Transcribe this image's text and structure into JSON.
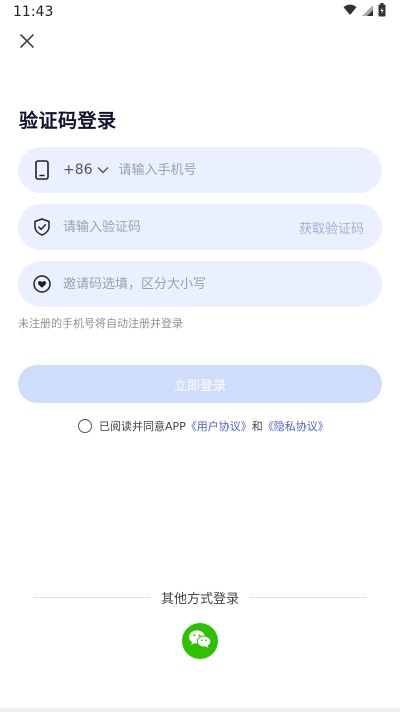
{
  "status_bar": {
    "time": "11:43",
    "icons": [
      "wifi-icon",
      "signal-icon",
      "battery-icon"
    ]
  },
  "header": {
    "close_icon": "close-icon"
  },
  "title": "验证码登录",
  "phone": {
    "icon": "phone-icon",
    "country_code": "+86",
    "placeholder": "请输入手机号",
    "value": ""
  },
  "code": {
    "icon": "shield-icon",
    "placeholder": "请输入验证码",
    "value": "",
    "get_code_label": "获取验证码"
  },
  "invite": {
    "icon": "heart-icon",
    "placeholder": "邀请码选填，区分大小写",
    "value": ""
  },
  "hint": "未注册的手机号将自动注册并登录",
  "login_button": "立即登录",
  "agreement": {
    "prefix": "已阅读并同意APP",
    "user_agreement": "《用户协议》",
    "and": "和",
    "privacy_policy": "《隐私协议》",
    "checked": false
  },
  "other_login": {
    "label": "其他方式登录",
    "wechat_icon": "wechat-icon"
  },
  "colors": {
    "field_bg": "#eaf0fd",
    "button_bg": "#cfdcfb",
    "link": "#4a5fd6",
    "wechat": "#2dc100",
    "title": "#10132e"
  }
}
